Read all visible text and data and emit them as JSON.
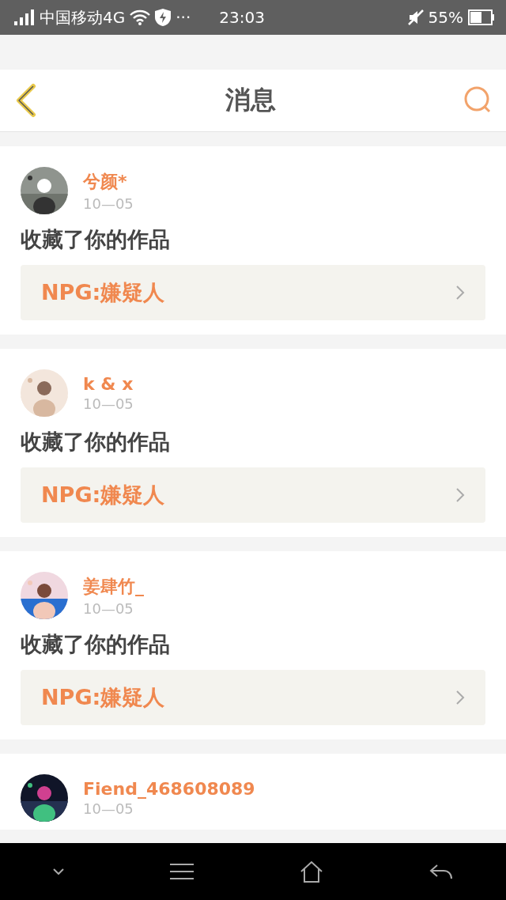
{
  "status_bar": {
    "carrier": "中国移动4G",
    "dots": "···",
    "time": "23:03",
    "battery": "55%"
  },
  "header": {
    "title": "消息"
  },
  "messages": [
    {
      "user": "兮颜*",
      "date": "10—05",
      "action": "收藏了你的作品",
      "work": "NPG:嫌疑人"
    },
    {
      "user": "k & x",
      "date": "10—05",
      "action": "收藏了你的作品",
      "work": "NPG:嫌疑人"
    },
    {
      "user": "姜肆竹_",
      "date": "10—05",
      "action": "收藏了你的作品",
      "work": "NPG:嫌疑人"
    },
    {
      "user": "Fiend_468608089",
      "date": "10—05"
    }
  ]
}
